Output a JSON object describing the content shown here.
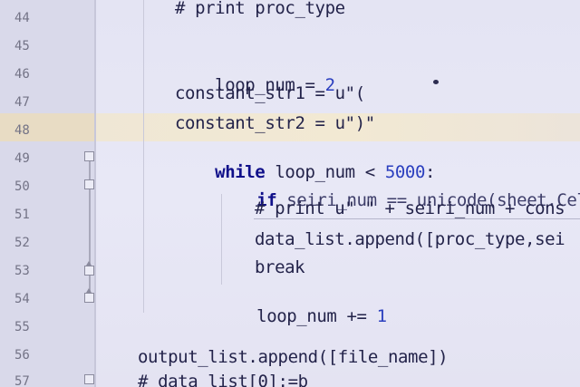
{
  "editor": {
    "line_numbers": [
      "44",
      "45",
      "46",
      "47",
      "48",
      "49",
      "50",
      "51",
      "52",
      "53",
      "54",
      "55",
      "56",
      "57"
    ],
    "highlighted_line": "48",
    "lines": {
      "l44": "# print proc_type",
      "l46a": "loop_num = ",
      "l46b": "2",
      "l47": "constant_str1 = u\"(",
      "l48": "constant_str2 = u\")\"",
      "l49a": "while",
      "l49b": " loop_num < ",
      "l49c": "5000",
      "l49d": ":",
      "l50a": "if",
      "l50b": " seiri_num == unicode(sheet.Cell",
      "l51": "# print u\" \" + seiri_num + cons",
      "l52": "data_list.append([proc_type,sei",
      "l53": "break",
      "l54a": "loop_num += ",
      "l54b": "1",
      "l56": "output_list.append([file_name])",
      "l57": "# data_list[0]:=b"
    }
  }
}
